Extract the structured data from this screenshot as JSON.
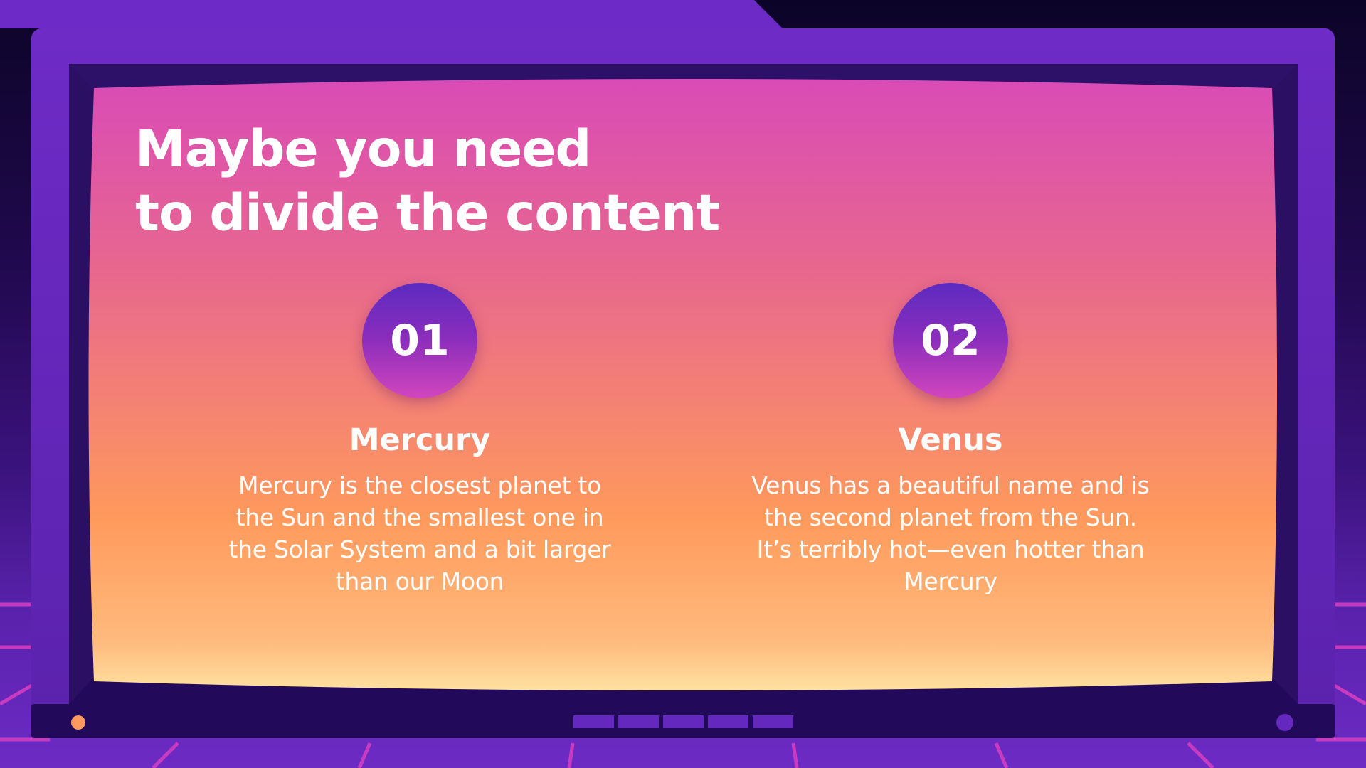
{
  "slide": {
    "title_lines": [
      "Maybe you need",
      "to divide the content"
    ]
  },
  "items": [
    {
      "number": "01",
      "title": "Mercury",
      "text": "Mercury is the closest planet to the Sun and the smallest one in the Solar System and a bit larger than our Moon"
    },
    {
      "number": "02",
      "title": "Venus",
      "text": "Venus has a beautiful name and is the second planet from the Sun. It’s terribly hot—even hotter than Mercury"
    }
  ],
  "colors": {
    "frame": "#6528be",
    "bezel": "#2a0f63",
    "screen_top": "#d94bb6",
    "screen_mid": "#ff9a5c",
    "screen_bottom": "#ffe1a0",
    "grid_line": "#d93fc2",
    "power_light": "#ff9a5c"
  }
}
